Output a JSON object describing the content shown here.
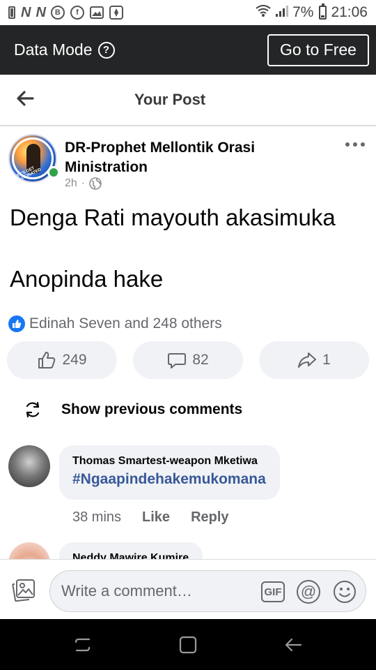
{
  "status_bar": {
    "battery_percent": "7%",
    "time": "21:06",
    "left_icons": [
      "battery-small-icon",
      "n-icon",
      "n-icon",
      "b-circle-icon",
      "facebook-circle-icon",
      "gallery-icon",
      "compass-icon"
    ],
    "right_icons": [
      "wifi-icon",
      "signal-icon",
      "battery-icon"
    ]
  },
  "data_bar": {
    "title": "Data Mode",
    "help_icon": "question-circle-icon",
    "button_label": "Go to Free"
  },
  "header": {
    "back_icon": "arrow-left-icon",
    "title": "Your Post"
  },
  "post": {
    "author": "DR-Prophet Mellontik Orasi Ministration",
    "time": "2h",
    "separator": "·",
    "audience_icon": "globe-icon",
    "text": "Denga Rati mayouth akasimuka\n\nAnopinda hake",
    "avatar_badge_text": "LET'S GET VACCINATED",
    "reactions_summary": "Edinah Seven and 248 others",
    "like_count": "249",
    "comment_count": "82",
    "share_count": "1"
  },
  "comments_section": {
    "show_previous_label": "Show previous comments",
    "comments": [
      {
        "name": "Thomas Smartest-weapon Mketiwa",
        "text": "#Ngaapindehakemukomana",
        "time": "38 mins",
        "like_label": "Like",
        "reply_label": "Reply"
      },
      {
        "name": "Neddy Mawire Kumire"
      }
    ]
  },
  "composer": {
    "placeholder": "Write a comment…",
    "gif_label": "GIF",
    "at_label": "@"
  },
  "colors": {
    "brand_blue": "#1877f2",
    "dark_bar": "#242526",
    "hashtag_blue": "#385898",
    "online_green": "#31a24c",
    "secondary_text": "#65676b"
  }
}
